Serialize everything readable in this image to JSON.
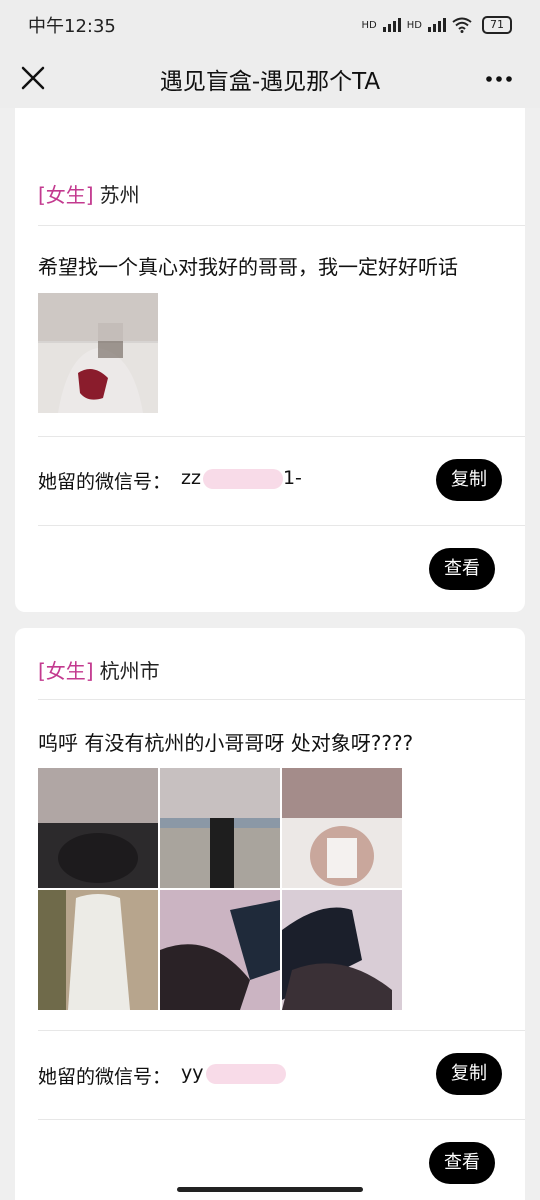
{
  "status": {
    "time": "中午12:35",
    "signal_1": "HD",
    "signal_2": "HD",
    "battery": "71"
  },
  "nav": {
    "title": "遇见盲盒-遇见那个TA"
  },
  "posts": [
    {
      "gender_label": "[女生]",
      "city": "苏州",
      "text": "希望找一个真心对我好的哥哥，我一定好好听话",
      "wechat_label": "她留的微信号：",
      "wechat_id_visible": "zz",
      "wechat_id_tail": "1-",
      "copy_label": "复制",
      "view_label": "查看",
      "photo_count": 1
    },
    {
      "gender_label": "[女生]",
      "city": "杭州市",
      "text": "呜呼 有没有杭州的小哥哥呀 处对象呀????",
      "wechat_label": "她留的微信号：",
      "wechat_id_visible": "yy",
      "copy_label": "复制",
      "view_label": "查看",
      "photo_count": 6
    }
  ]
}
